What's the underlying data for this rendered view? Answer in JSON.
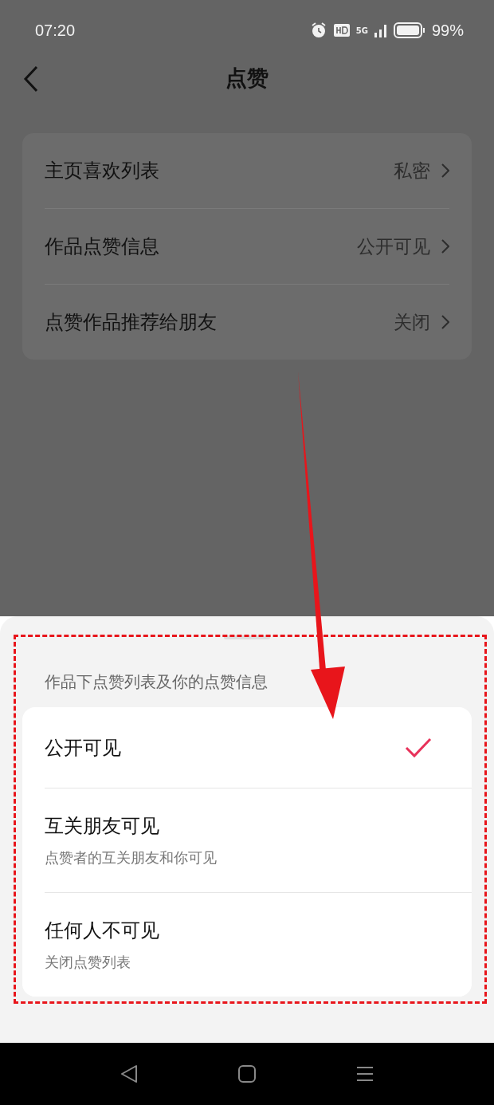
{
  "status_bar": {
    "time": "07:20",
    "network": "5G",
    "battery": "99%"
  },
  "header": {
    "title": "点赞"
  },
  "settings": [
    {
      "label": "主页喜欢列表",
      "value": "私密"
    },
    {
      "label": "作品点赞信息",
      "value": "公开可见"
    },
    {
      "label": "点赞作品推荐给朋友",
      "value": "关闭"
    }
  ],
  "sheet": {
    "title": "作品下点赞列表及你的点赞信息",
    "options": [
      {
        "label": "公开可见",
        "selected": true
      },
      {
        "label": "互关朋友可见",
        "description": "点赞者的互关朋友和你可见",
        "selected": false
      },
      {
        "label": "任何人不可见",
        "description": "关闭点赞列表",
        "selected": false
      }
    ]
  }
}
